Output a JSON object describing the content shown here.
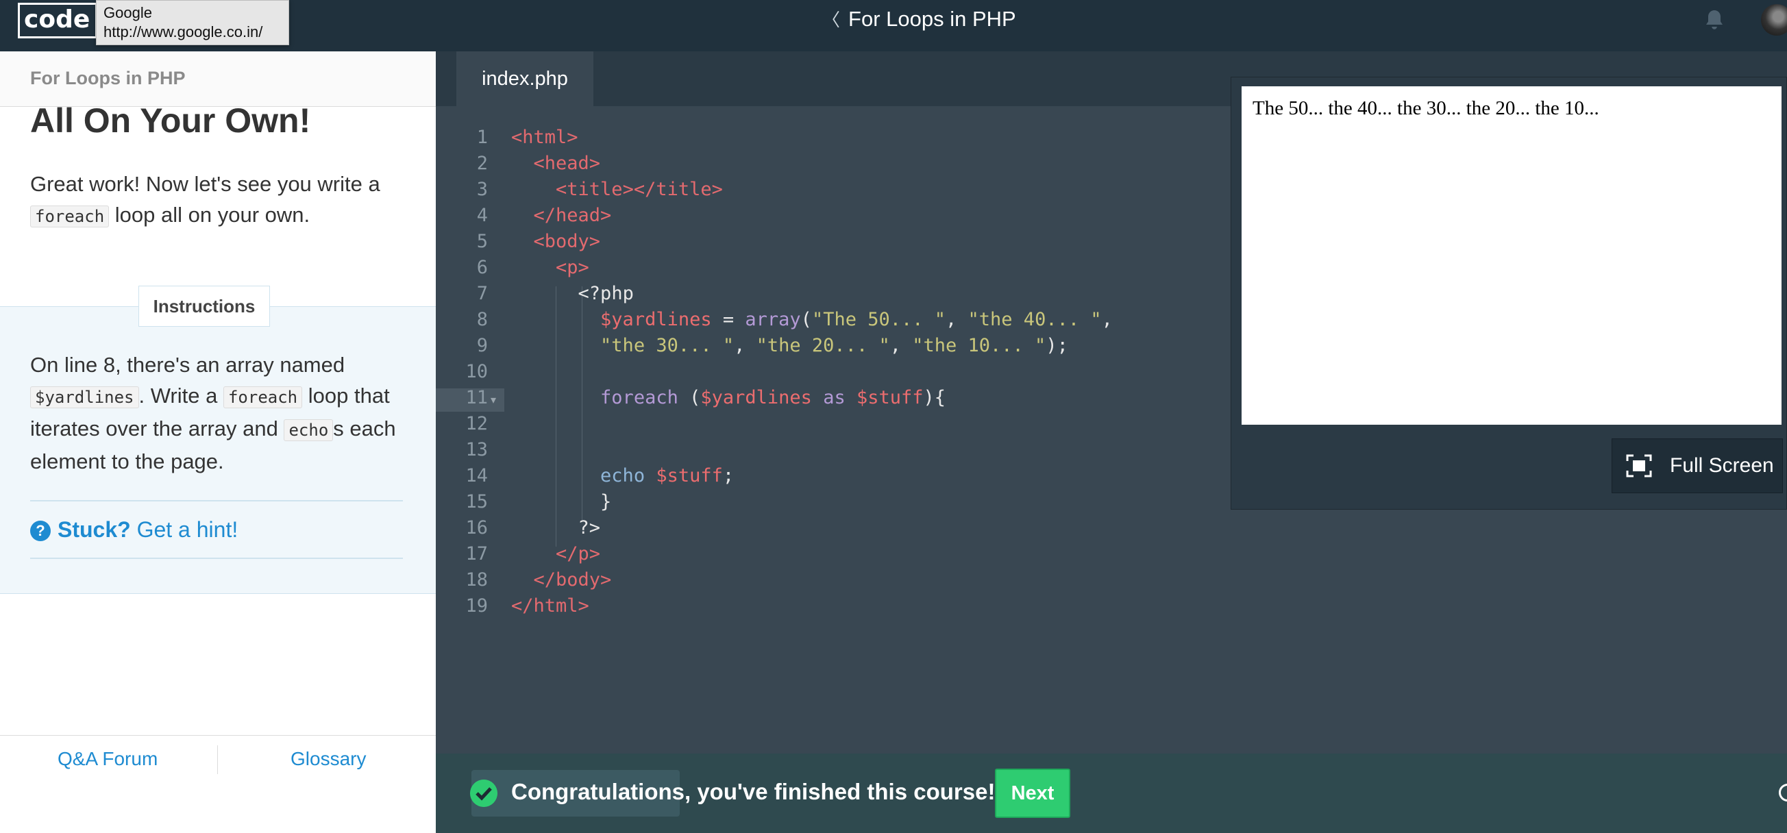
{
  "topbar": {
    "logo_text": "code",
    "course_title": "For Loops in PHP",
    "back_chevron": "〈",
    "tooltip": {
      "title": "Google",
      "url": "http://www.google.co.in/"
    },
    "icons": [
      "bell-icon",
      "avatar"
    ]
  },
  "lesson": {
    "header": "For Loops in PHP",
    "title": "All On Your Own!",
    "intro": {
      "before": "Great work! Now let's see you write a",
      "code": "foreach",
      "after": "loop all on your own."
    },
    "instructions_label": "Instructions",
    "instructions": {
      "p1": "On line 8, there's an array named",
      "code1": "$yardlines",
      "p2": ". Write a",
      "code2": "foreach",
      "p3": "loop that iterates over the array and",
      "code3": "echo",
      "p4": "s each element to the page."
    },
    "hint": {
      "stuck": "Stuck?",
      "link": "Get a hint!"
    },
    "footer": {
      "qa": "Q&A Forum",
      "glossary": "Glossary"
    }
  },
  "editor": {
    "tab": "index.php",
    "line_numbers": [
      "1",
      "2",
      "3",
      "4",
      "5",
      "6",
      "7",
      "8",
      "9",
      "10",
      "11",
      "12",
      "13",
      "14",
      "15",
      "16",
      "17",
      "18",
      "19"
    ],
    "tokens": {
      "html_open": "<html>",
      "head_open": "<head>",
      "title": "<title></title>",
      "head_close": "</head>",
      "body_open": "<body>",
      "p_open": "<p>",
      "php_open": "<?php",
      "var": "$yardlines",
      "assign": " = ",
      "array_fn": "array",
      "paren_open": "(",
      "s1": "\"The 50... \"",
      "s2": "\"the 40... \"",
      "s3": "\"the 30... \"",
      "s4": "\"the 20... \"",
      "s5": "\"the 10... \"",
      "comma": ", ",
      "end_stmt": ");",
      "foreach_kw": "foreach",
      "as_kw": "as",
      "stuff": "$stuff",
      "echo_kw": "echo",
      "semicolon": ";",
      "brace_open": "){",
      "brace_close": "}",
      "php_close": "?>",
      "p_close": "</p>",
      "body_close": "</body>",
      "html_close": "</html>"
    }
  },
  "preview": {
    "output": "The 50... the 40... the 30... the 20... the 10...",
    "fullscreen_label": "Full Screen"
  },
  "bottom": {
    "message": "Congratulations, you've finished this course!",
    "next_label": "Next"
  },
  "colors": {
    "topbar": "#20313d",
    "editor_bg": "#394752",
    "accent_blue": "#1e8bd1",
    "success_green": "#2ecc71",
    "tag_red": "#e36a6f",
    "string_yellow": "#c9c67b",
    "keyword_purple": "#b49ad6"
  }
}
